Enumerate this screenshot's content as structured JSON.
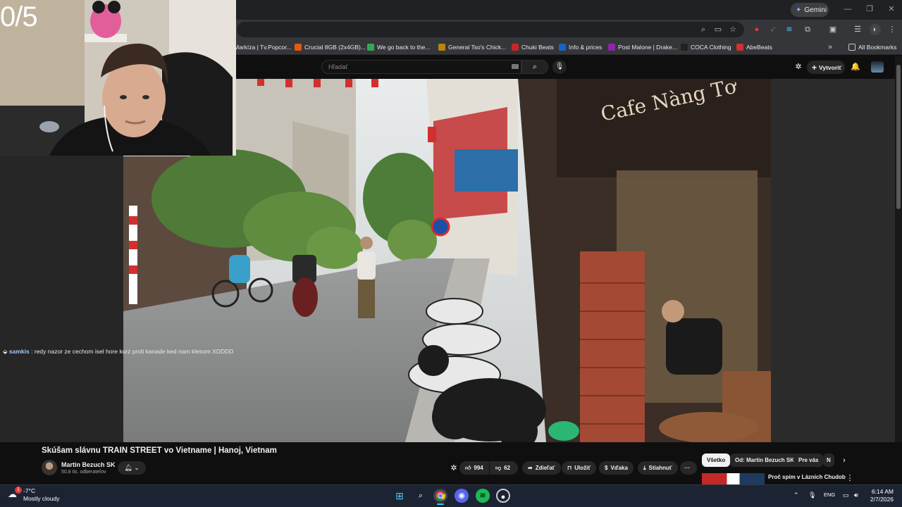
{
  "overlay": {
    "counter": "0/5"
  },
  "browser": {
    "gemini_label": "Gemini",
    "bookmarks": [
      {
        "label": "Markíza | Tv.Popcor...",
        "color": "#3b3b3b"
      },
      {
        "label": "Crucial 8GB (2x4GB)...",
        "color": "#e8590c"
      },
      {
        "label": "We go back to the...",
        "color": "#34a853"
      },
      {
        "label": "General Tso's Chick...",
        "color": "#b8860b"
      },
      {
        "label": "Chuki Beats",
        "color": "#c62828"
      },
      {
        "label": "Info & prices",
        "color": "#1565c0"
      },
      {
        "label": "Post Malone | Drake...",
        "color": "#8e24aa"
      },
      {
        "label": "COCA Clothing",
        "color": "#222222"
      },
      {
        "label": "AbeBeats",
        "color": "#d32f2f"
      }
    ],
    "all_bookmarks": "All Bookmarks"
  },
  "youtube": {
    "search_placeholder": "Hľadať",
    "create_label": "Vytvoriť"
  },
  "chat": {
    "user": "samkis",
    "message": "redy nazor ze cechom isel hore kurz proti kanade ked nam klesom XDDDD"
  },
  "video": {
    "title": "Skúšam slávnu TRAIN STREET vo Vietname | Hanoj, Vietnam",
    "channel": "Martin Bezuch SK",
    "subscribers": "50,8 tis. odberateľov",
    "likes": "994",
    "dislikes": "62",
    "share": "Zdieľať",
    "save": "Uložiť",
    "thanks": "Vďaka",
    "download": "Stiahnuť",
    "more": "···"
  },
  "chips": [
    "Všetko",
    "Od: Martin Bezuch SK",
    "Pre vás",
    "N"
  ],
  "related": {
    "title": "Proč spím v Lázních Chudoba? | Dobrodružství jste v | První"
  },
  "taskbar": {
    "temperature": "-7°C",
    "condition": "Mostly cloudy",
    "weather_badge": "1",
    "language": "ENG",
    "time": "6:14 AM",
    "date": "2/7/2026"
  }
}
